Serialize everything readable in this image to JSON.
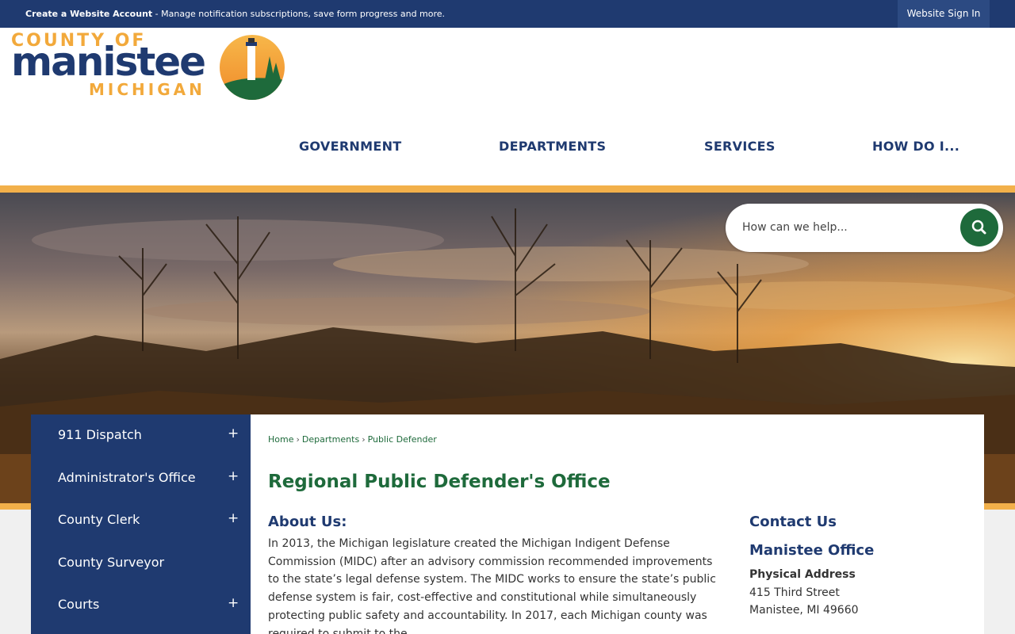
{
  "topbar": {
    "account_bold": "Create a Website Account",
    "account_text": " - Manage notification subscriptions, save form progress and more.",
    "signin_label": "Website Sign In"
  },
  "logo": {
    "line1": "COUNTY OF",
    "line2": "manistee",
    "line3": "MICHIGAN",
    "emblem_icon": "lighthouse-icon"
  },
  "nav": {
    "items": [
      {
        "label": "GOVERNMENT"
      },
      {
        "label": "DEPARTMENTS"
      },
      {
        "label": "SERVICES"
      },
      {
        "label": "HOW DO I..."
      }
    ]
  },
  "search": {
    "placeholder": "How can we help...",
    "icon": "search-icon"
  },
  "sidebar": {
    "items": [
      {
        "label": "911 Dispatch",
        "expand": "+"
      },
      {
        "label": "Administrator's Office",
        "expand": "+"
      },
      {
        "label": "County Clerk",
        "expand": "+"
      },
      {
        "label": "County Surveyor",
        "expand": ""
      },
      {
        "label": "Courts",
        "expand": "+"
      }
    ]
  },
  "breadcrumb": {
    "items": [
      {
        "label": "Home"
      },
      {
        "label": "Departments"
      },
      {
        "label": "Public Defender"
      }
    ],
    "separator": "›"
  },
  "main": {
    "title": "Regional Public Defender's Office",
    "about_heading": "About Us:",
    "about_text": "In 2013, the Michigan legislature created the Michigan Indigent Defense Commission (MIDC) after an advisory commission recommended improvements to the state’s legal defense system. The MIDC works to ensure the state’s public defense system is fair, cost-effective and constitutional while simultaneously protecting public safety and accountability. In 2017, each Michigan county was required to submit to the"
  },
  "contact": {
    "heading": "Contact Us",
    "office": "Manistee Office",
    "address_label": "Physical Address",
    "address_line1": "415 Third Street",
    "address_line2": "Manistee, MI 49660"
  },
  "colors": {
    "navy": "#1f3a70",
    "green": "#1e6a3b",
    "orange": "#f2b04a"
  }
}
